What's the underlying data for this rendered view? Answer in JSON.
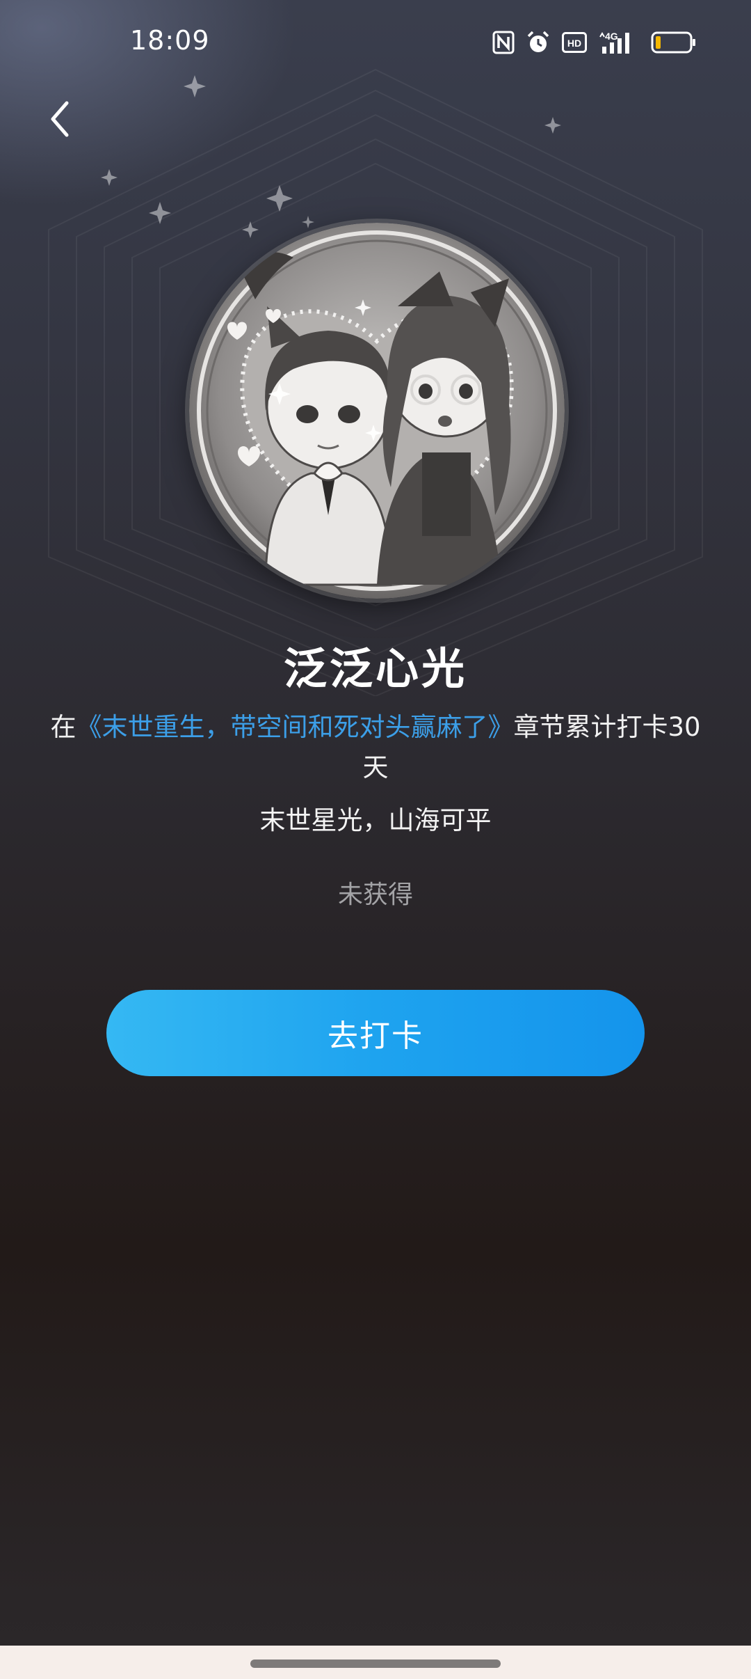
{
  "status_bar": {
    "time": "18:09",
    "network_label": "4G",
    "hd_label": "HD",
    "icons": [
      "nfc-icon",
      "alarm-icon",
      "hd-icon",
      "signal-4g-icon",
      "battery-low-icon"
    ],
    "battery_color": "#f5b800"
  },
  "header": {
    "back_icon": "chevron-left-icon"
  },
  "medal": {
    "image": "chibi-couple-medal-grayscale",
    "state": "locked-grayscale"
  },
  "badge": {
    "title": "泛泛心光",
    "condition_prefix": "在",
    "book_title": "《末世重生，带空间和死对头赢麻了》",
    "condition_suffix": "章节累计打卡30天",
    "motto": "末世星光，山海可平",
    "status": "未获得"
  },
  "actions": {
    "checkin_label": "去打卡"
  },
  "colors": {
    "accent_blue": "#1ea3ef",
    "link_blue": "#3c9fe8",
    "status_gray": "#a3a3a6"
  }
}
